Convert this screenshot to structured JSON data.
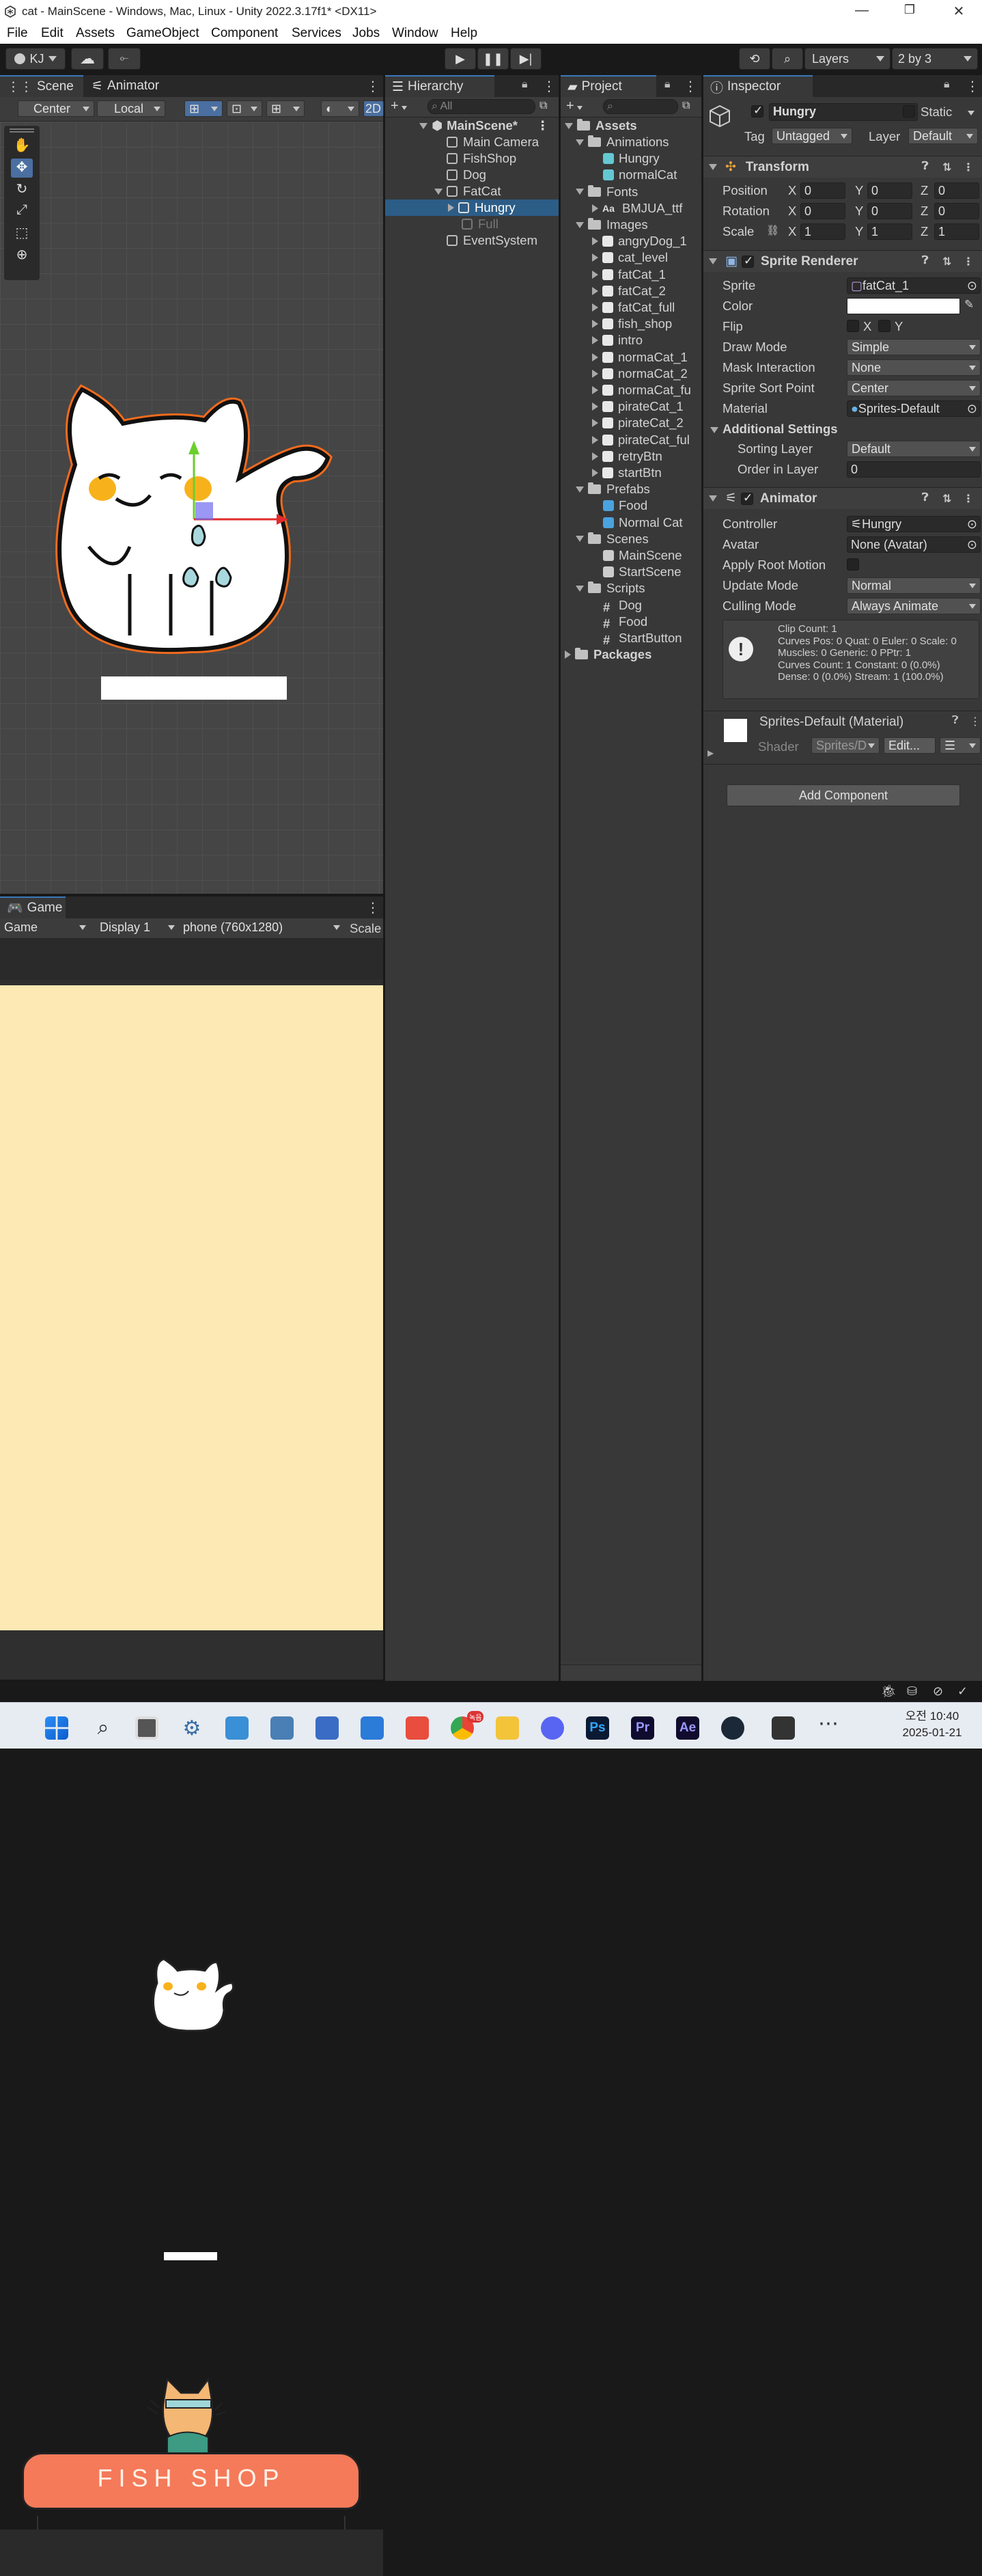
{
  "window": {
    "title": "cat - MainScene - Windows, Mac, Linux - Unity 2022.3.17f1* <DX11>"
  },
  "menu": [
    "File",
    "Edit",
    "Assets",
    "GameObject",
    "Component",
    "Services",
    "Jobs",
    "Window",
    "Help"
  ],
  "toolbar": {
    "account": "KJ",
    "layers": "Layers",
    "layout": "2 by 3"
  },
  "scene": {
    "tabs": [
      "Scene",
      "Animator"
    ],
    "pivot": "Center",
    "space": "Local",
    "mode2d": "2D"
  },
  "game": {
    "tab": "Game",
    "display_mode": "Game",
    "display": "Display 1",
    "resolution": "phone (760x1280)",
    "scale": "Scale",
    "shop_sign": "FISH SHOP"
  },
  "hierarchy": {
    "tab": "Hierarchy",
    "search_placeholder": "All",
    "scene_name": "MainScene*",
    "items": [
      "Main Camera",
      "FishShop",
      "Dog",
      "FatCat",
      "Hungry",
      "Full",
      "EventSystem"
    ]
  },
  "project": {
    "tab": "Project",
    "root": "Assets",
    "rows": [
      {
        "label": "Animations",
        "type": "folder",
        "depth": 1,
        "open": true
      },
      {
        "label": "Hungry",
        "type": "anim",
        "depth": 2
      },
      {
        "label": "normalCat",
        "type": "anim",
        "depth": 2
      },
      {
        "label": "Fonts",
        "type": "folder",
        "depth": 1,
        "open": true
      },
      {
        "label": "BMJUA_ttf",
        "type": "font",
        "depth": 2,
        "arrow": true
      },
      {
        "label": "Images",
        "type": "folder",
        "depth": 1,
        "open": true
      },
      {
        "label": "angryDog_1",
        "type": "img",
        "depth": 2,
        "arrow": true
      },
      {
        "label": "cat_level",
        "type": "img",
        "depth": 2,
        "arrow": true
      },
      {
        "label": "fatCat_1",
        "type": "img",
        "depth": 2,
        "arrow": true
      },
      {
        "label": "fatCat_2",
        "type": "img",
        "depth": 2,
        "arrow": true
      },
      {
        "label": "fatCat_full",
        "type": "img",
        "depth": 2,
        "arrow": true
      },
      {
        "label": "fish_shop",
        "type": "img",
        "depth": 2,
        "arrow": true
      },
      {
        "label": "intro",
        "type": "img",
        "depth": 2,
        "arrow": true
      },
      {
        "label": "normaCat_1",
        "type": "img",
        "depth": 2,
        "arrow": true
      },
      {
        "label": "normaCat_2",
        "type": "img",
        "depth": 2,
        "arrow": true
      },
      {
        "label": "normaCat_fu",
        "type": "img",
        "depth": 2,
        "arrow": true
      },
      {
        "label": "pirateCat_1",
        "type": "img",
        "depth": 2,
        "arrow": true
      },
      {
        "label": "pirateCat_2",
        "type": "img",
        "depth": 2,
        "arrow": true
      },
      {
        "label": "pirateCat_ful",
        "type": "img",
        "depth": 2,
        "arrow": true
      },
      {
        "label": "retryBtn",
        "type": "img",
        "depth": 2,
        "arrow": true
      },
      {
        "label": "startBtn",
        "type": "img",
        "depth": 2,
        "arrow": true
      },
      {
        "label": "Prefabs",
        "type": "folder",
        "depth": 1,
        "open": true
      },
      {
        "label": "Food",
        "type": "prefab",
        "depth": 2
      },
      {
        "label": "Normal Cat",
        "type": "prefab",
        "depth": 2
      },
      {
        "label": "Scenes",
        "type": "folder",
        "depth": 1,
        "open": true
      },
      {
        "label": "MainScene",
        "type": "scene",
        "depth": 2
      },
      {
        "label": "StartScene",
        "type": "scene",
        "depth": 2
      },
      {
        "label": "Scripts",
        "type": "folder",
        "depth": 1,
        "open": true
      },
      {
        "label": "Dog",
        "type": "script",
        "depth": 2
      },
      {
        "label": "Food",
        "type": "script",
        "depth": 2
      },
      {
        "label": "StartButton",
        "type": "script",
        "depth": 2
      }
    ],
    "packages": "Packages"
  },
  "inspector": {
    "tab": "Inspector",
    "name": "Hungry",
    "static_label": "Static",
    "tag_label": "Tag",
    "tag": "Untagged",
    "layer_label": "Layer",
    "layer": "Default",
    "transform": {
      "title": "Transform",
      "position_label": "Position",
      "rotation_label": "Rotation",
      "scale_label": "Scale",
      "x": "X",
      "y": "Y",
      "z": "Z",
      "position": [
        "0",
        "0",
        "0"
      ],
      "rotation": [
        "0",
        "0",
        "0"
      ],
      "scale": [
        "1",
        "1",
        "1"
      ]
    },
    "sprite_renderer": {
      "title": "Sprite Renderer",
      "sprite_label": "Sprite",
      "sprite": "fatCat_1",
      "color_label": "Color",
      "flip_label": "Flip",
      "flip_x": "X",
      "flip_y": "Y",
      "draw_mode_label": "Draw Mode",
      "draw_mode": "Simple",
      "mask_label": "Mask Interaction",
      "mask": "None",
      "sort_point_label": "Sprite Sort Point",
      "sort_point": "Center",
      "material_label": "Material",
      "material": "Sprites-Default",
      "additional": "Additional Settings",
      "sorting_layer_label": "Sorting Layer",
      "sorting_layer": "Default",
      "order_label": "Order in Layer",
      "order": "0"
    },
    "animator": {
      "title": "Animator",
      "controller_label": "Controller",
      "controller": "Hungry",
      "avatar_label": "Avatar",
      "avatar": "None (Avatar)",
      "root_motion_label": "Apply Root Motion",
      "update_label": "Update Mode",
      "update": "Normal",
      "culling_label": "Culling Mode",
      "culling": "Always Animate",
      "info": [
        "Clip Count: 1",
        "Curves Pos: 0 Quat: 0 Euler: 0 Scale: 0",
        "Muscles: 0 Generic: 0 PPtr: 1",
        "Curves Count: 1 Constant: 0 (0.0%)",
        "Dense: 0 (0.0%) Stream: 1 (100.0%)"
      ]
    },
    "material": {
      "title": "Sprites-Default (Material)",
      "shader_label": "Shader",
      "shader": "Sprites/D",
      "edit": "Edit..."
    },
    "add_component": "Add Component"
  },
  "taskbar": {
    "time": "오전 10:40",
    "date": "2025-01-21",
    "badge": "녹음"
  },
  "colors": {
    "accent": "#3a79bb",
    "panel": "#383838",
    "game_bg": "#fde9b4",
    "awning": "#f47a5a"
  }
}
